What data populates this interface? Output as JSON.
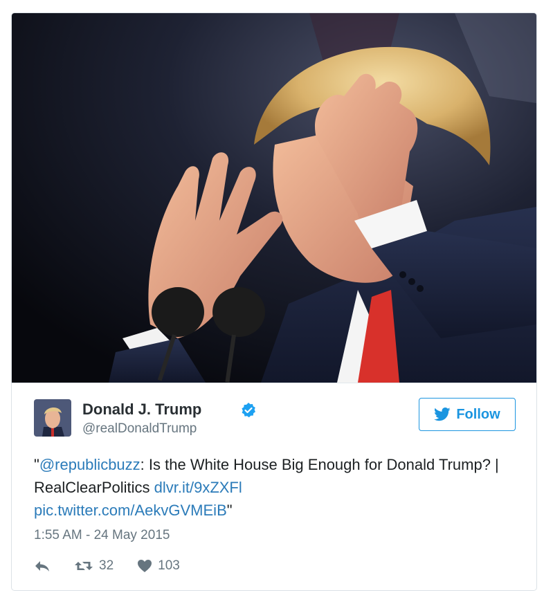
{
  "photo": {
    "description_icon": "photo-icon"
  },
  "user": {
    "name": "Donald J. Trump",
    "handle": "@realDonaldTrump",
    "verified_icon": "verified-badge-icon",
    "avatar_icon": "avatar"
  },
  "follow_button": {
    "label": "Follow",
    "icon": "twitter-bird-icon"
  },
  "tweet": {
    "open_quote": "\"",
    "mention": "@republicbuzz",
    "text_part": ": Is the White House Big Enough for Donald Trump? | RealClearPolitics ",
    "link1": "dlvr.it/9xZXFl",
    "link2": "pic.twitter.com/AekvGVMEiB",
    "close_quote": "\""
  },
  "timestamp": "1:55 AM - 24 May 2015",
  "actions": {
    "reply_icon": "reply-icon",
    "retweet_icon": "retweet-icon",
    "retweet_count": "32",
    "like_icon": "heart-icon",
    "like_count": "103"
  },
  "colors": {
    "link": "#2b7bb9",
    "follow": "#1b95e0",
    "text": "#1c2022",
    "muted": "#66757f"
  }
}
